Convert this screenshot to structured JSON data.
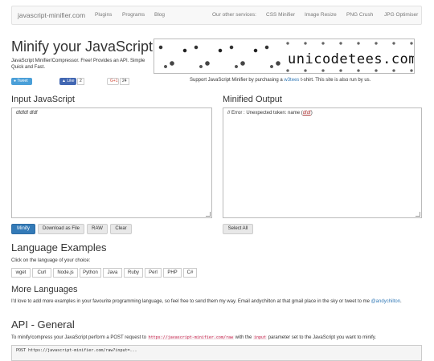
{
  "navbar": {
    "brand": "javascript-minifier.com",
    "links": [
      "Plugins",
      "Programs",
      "Blog"
    ],
    "services_label": "Our other services:",
    "services": [
      "CSS Minifier",
      "Image Resize",
      "PNG Crush",
      "JPG Optimiser"
    ]
  },
  "header": {
    "title": "Minify your JavaScript",
    "tagline": "JavaScript Minifier/Compressor. Free! Provides an API. Simple Quick and Fast."
  },
  "banner": {
    "text": "unicodetees.com"
  },
  "social": {
    "tweet": "Tweet",
    "like": "Like",
    "like_count": "2",
    "gplus": "G+1",
    "gplus_count": "24"
  },
  "support": {
    "prefix": "Support JavaScript Minifier by purchasing a ",
    "link": "w3tees",
    "suffix": " t-shirt. This site is also run by us."
  },
  "input": {
    "label": "Input JavaScript",
    "value": "dfdfdf dfdf"
  },
  "output": {
    "label": "Minified Output",
    "error_prefix": "// Error : Unexpected token: name (",
    "error_token": "dfdf",
    "error_suffix": ")"
  },
  "buttons": {
    "minify": "Minify",
    "download": "Download as File",
    "raw": "RAW",
    "clear": "Clear",
    "select_all": "Select All"
  },
  "language_examples": {
    "title": "Language Examples",
    "subtitle": "Click on the language of your choice:",
    "languages": [
      "wget",
      "Curl",
      "Node.js",
      "Python",
      "Java",
      "Ruby",
      "Perl",
      "PHP",
      "C#"
    ]
  },
  "more_languages": {
    "title": "More Languages",
    "text": "I'd love to add more examples in your favourite programming language, so feel free to send them my way. Email andychilton at that gmail place in the sky or tweet to me ",
    "handle": "@andychilton",
    "end": "."
  },
  "api": {
    "title": "API - General",
    "text_prefix": "To minify/compress your JavaScript perform a POST request to ",
    "url": "https://javascript-minifier.com/raw",
    "text_mid": " with the ",
    "param": "input",
    "text_suffix": " parameter set to the JavaScript you want to minify.",
    "code": "POST https://javascript-minifier.com/raw?input=..."
  }
}
